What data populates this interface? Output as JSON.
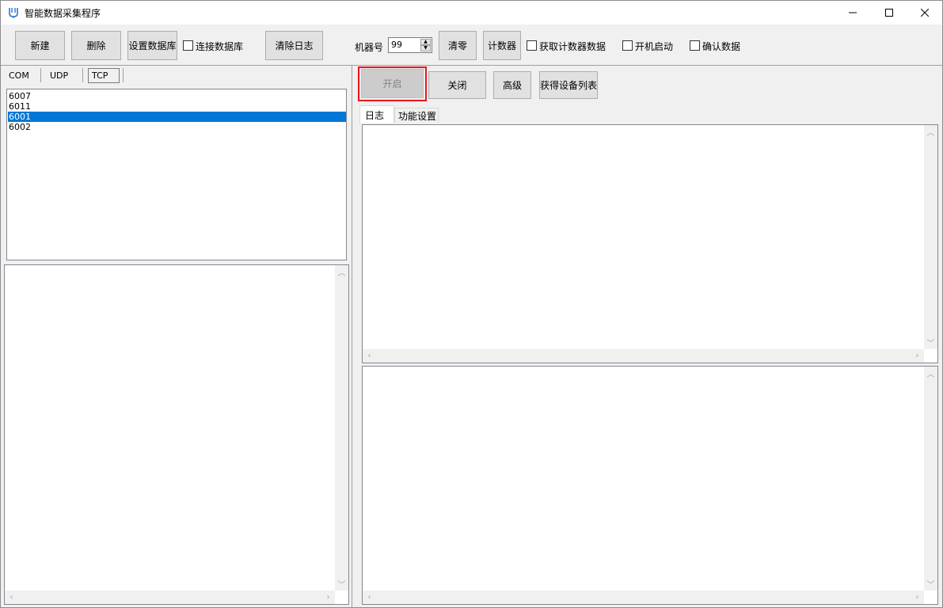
{
  "window": {
    "title": "智能数据采集程序",
    "minimize_icon": "minimize-icon",
    "maximize_icon": "maximize-icon",
    "close_icon": "close-icon"
  },
  "toolbar": {
    "new_label": "新建",
    "delete_label": "删除",
    "set_db_label": "设置数据库",
    "connect_db_label": "连接数据库",
    "clear_log_label": "清除日志",
    "machine_no_label": "机器号",
    "machine_no_value": "99",
    "reset_label": "清零",
    "counter_label": "计数器",
    "get_counter_data_label": "获取计数器数据",
    "autostart_label": "开机启动",
    "confirm_data_label": "确认数据"
  },
  "left_panel": {
    "tabs": [
      "COM",
      "UDP",
      "TCP"
    ],
    "active_tab": "TCP",
    "ports": [
      "6007",
      "6011",
      "6001",
      "6002"
    ],
    "selected_port": "6001"
  },
  "right_panel": {
    "open_label": "开启",
    "close_label": "关闭",
    "advanced_label": "高级",
    "device_list_label": "获得设备列表",
    "tabs": [
      "日志",
      "功能设置"
    ],
    "active_tab": "日志"
  },
  "colors": {
    "selection": "#0078d7",
    "highlight_border": "#e8141c"
  }
}
